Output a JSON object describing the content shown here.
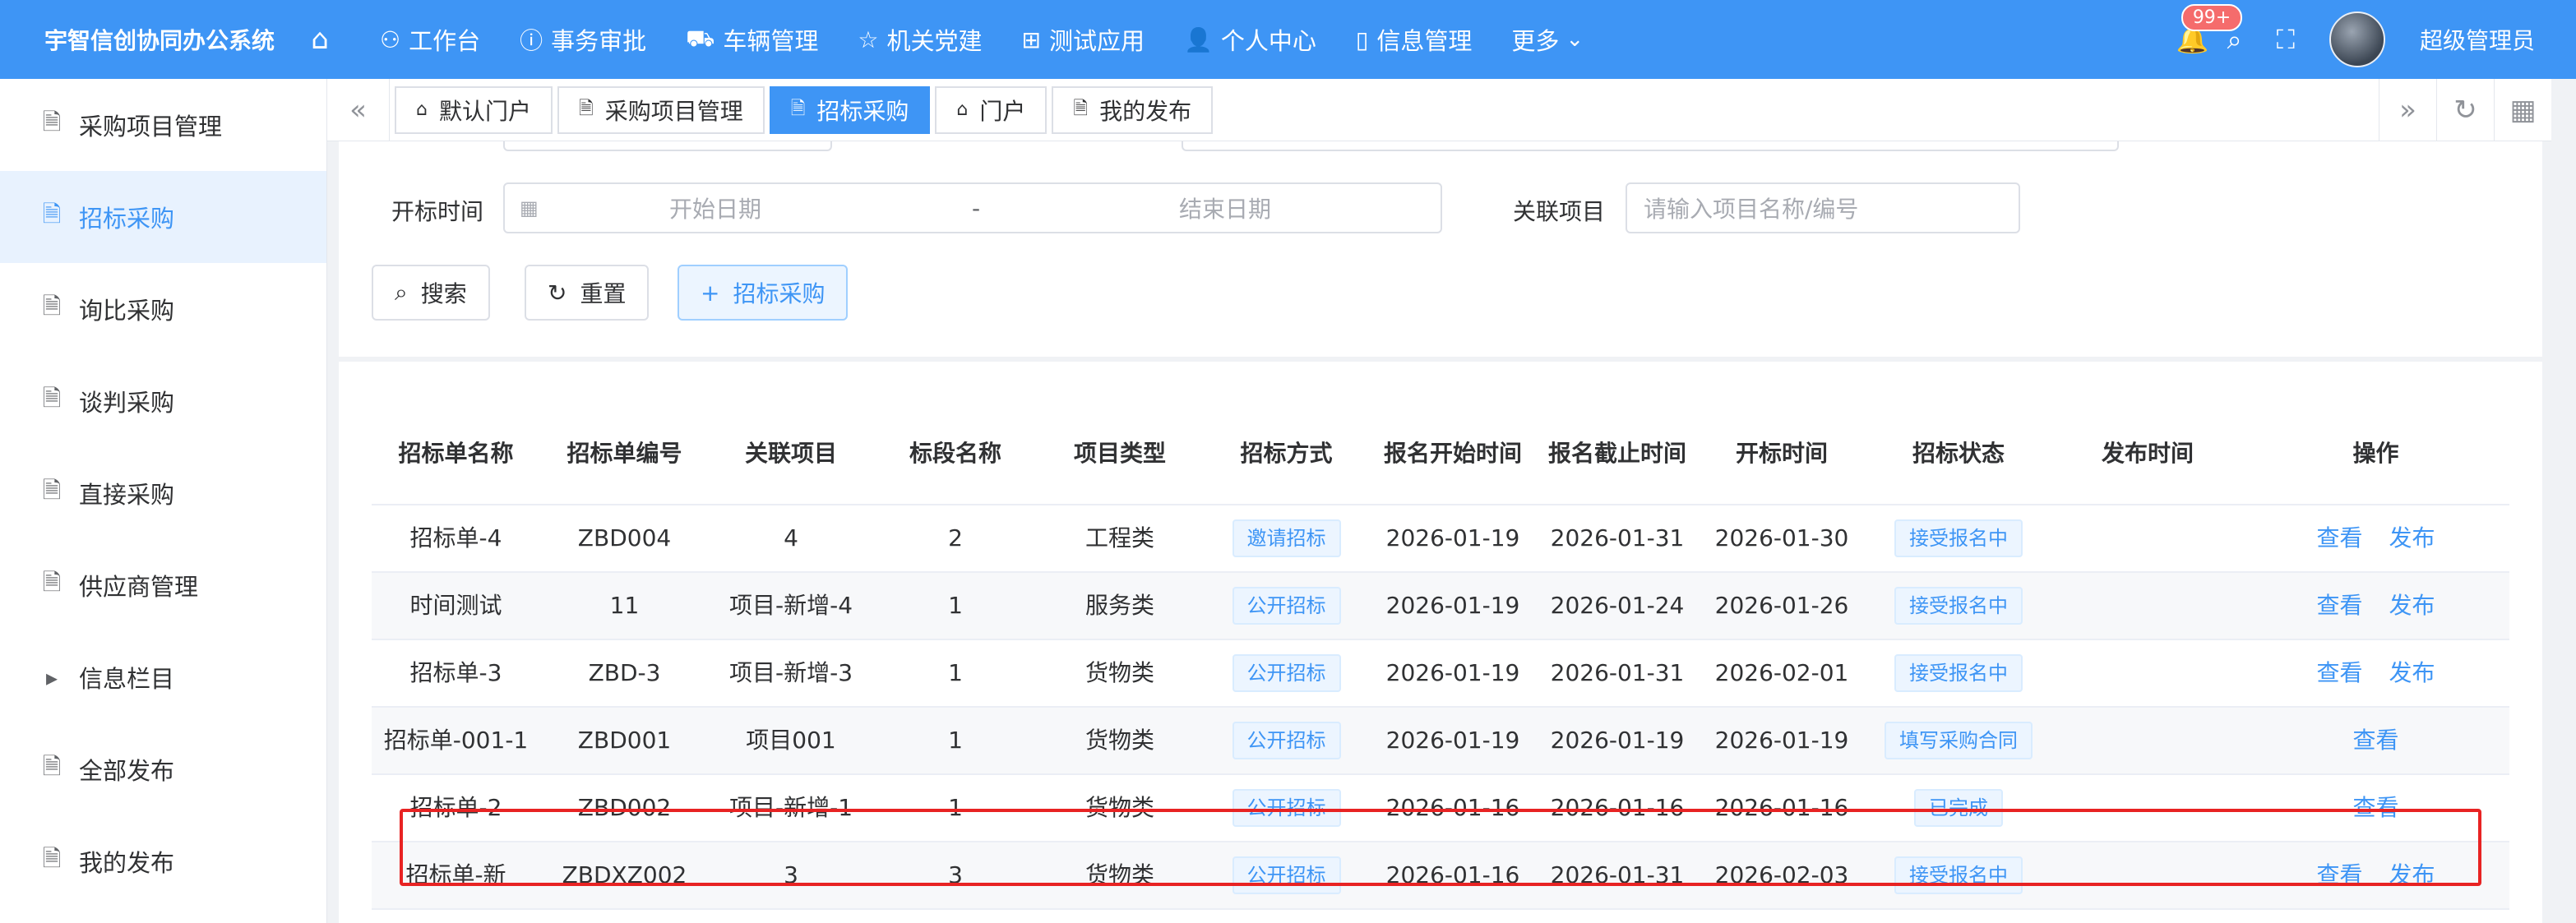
{
  "app": {
    "title": "宇智信创协同办公系统",
    "nav": [
      {
        "icon": "workbench-icon",
        "glyph": "⚇",
        "label": "工作台"
      },
      {
        "icon": "info-circle-icon",
        "glyph": "ⓘ",
        "label": "事务审批"
      },
      {
        "icon": "car-icon",
        "glyph": "⛟",
        "label": "车辆管理"
      },
      {
        "icon": "star-icon",
        "glyph": "☆",
        "label": "机关党建"
      },
      {
        "icon": "box-icon",
        "glyph": "⊞",
        "label": "测试应用"
      },
      {
        "icon": "user-icon",
        "glyph": "👤",
        "label": "个人中心"
      },
      {
        "icon": "book-icon",
        "glyph": "▯",
        "label": "信息管理"
      },
      {
        "icon": "chevron-down-icon",
        "glyph": "⌄",
        "label": "更多"
      }
    ],
    "notification_count": "99+",
    "user_name": "超级管理员"
  },
  "sidebar": {
    "items": [
      {
        "label": "采购项目管理",
        "icon": "document-icon",
        "active": false
      },
      {
        "label": "招标采购",
        "icon": "document-icon",
        "active": true
      },
      {
        "label": "询比采购",
        "icon": "document-icon",
        "active": false
      },
      {
        "label": "谈判采购",
        "icon": "document-icon",
        "active": false
      },
      {
        "label": "直接采购",
        "icon": "document-icon",
        "active": false
      },
      {
        "label": "供应商管理",
        "icon": "document-icon",
        "active": false
      },
      {
        "label": "信息栏目",
        "icon": "caret-right-icon",
        "active": false
      },
      {
        "label": "全部发布",
        "icon": "document-icon",
        "active": false
      },
      {
        "label": "我的发布",
        "icon": "document-icon",
        "active": false
      }
    ]
  },
  "tabs": [
    {
      "label": "默认门户",
      "icon": "home-icon",
      "active": false
    },
    {
      "label": "采购项目管理",
      "icon": "document-icon",
      "active": false
    },
    {
      "label": "招标采购",
      "icon": "document-icon",
      "active": true
    },
    {
      "label": "门户",
      "icon": "home-icon",
      "active": false
    },
    {
      "label": "我的发布",
      "icon": "document-icon",
      "active": false
    }
  ],
  "search": {
    "open_time_label": "开标时间",
    "start_placeholder": "开始日期",
    "range_separator": "-",
    "end_placeholder": "结束日期",
    "project_label": "关联项目",
    "project_placeholder": "请输入项目名称/编号",
    "search_btn": "搜索",
    "reset_btn": "重置",
    "add_btn": "招标采购"
  },
  "table": {
    "columns": [
      "招标单名称",
      "招标单编号",
      "关联项目",
      "标段名称",
      "项目类型",
      "招标方式",
      "报名开始时间",
      "报名截止时间",
      "开标时间",
      "招标状态",
      "发布时间",
      "操作"
    ],
    "rows": [
      {
        "name": "招标单-4",
        "code": "ZBD004",
        "project": "4",
        "section": "2",
        "type": "工程类",
        "method": "邀请招标",
        "reg_start": "2026-01-19",
        "reg_end": "2026-01-31",
        "open": "2026-01-30",
        "status": "接受报名中",
        "publish": "",
        "ops": [
          "查看",
          "发布"
        ]
      },
      {
        "name": "时间测试",
        "code": "11",
        "project": "项目-新增-4",
        "section": "1",
        "type": "服务类",
        "method": "公开招标",
        "reg_start": "2026-01-19",
        "reg_end": "2026-01-24",
        "open": "2026-01-26",
        "status": "接受报名中",
        "publish": "",
        "ops": [
          "查看",
          "发布"
        ]
      },
      {
        "name": "招标单-3",
        "code": "ZBD-3",
        "project": "项目-新增-3",
        "section": "1",
        "type": "货物类",
        "method": "公开招标",
        "reg_start": "2026-01-19",
        "reg_end": "2026-01-31",
        "open": "2026-02-01",
        "status": "接受报名中",
        "publish": "",
        "ops": [
          "查看",
          "发布"
        ]
      },
      {
        "name": "招标单-001-1",
        "code": "ZBD001",
        "project": "项目001",
        "section": "1",
        "type": "货物类",
        "method": "公开招标",
        "reg_start": "2026-01-19",
        "reg_end": "2026-01-19",
        "open": "2026-01-19",
        "status": "填写采购合同",
        "publish": "",
        "ops": [
          "查看"
        ]
      },
      {
        "name": "招标单-2",
        "code": "ZBD002",
        "project": "项目-新增-1",
        "section": "1",
        "type": "货物类",
        "method": "公开招标",
        "reg_start": "2026-01-16",
        "reg_end": "2026-01-16",
        "open": "2026-01-16",
        "status": "已完成",
        "publish": "",
        "ops": [
          "查看"
        ]
      },
      {
        "name": "招标单-新",
        "code": "ZBDXZ002",
        "project": "3",
        "section": "3",
        "type": "货物类",
        "method": "公开招标",
        "reg_start": "2026-01-16",
        "reg_end": "2026-01-31",
        "open": "2026-02-03",
        "status": "接受报名中",
        "publish": "",
        "ops": [
          "查看",
          "发布"
        ]
      }
    ]
  },
  "colors": {
    "accent": "#3e95f5",
    "highlight_border": "#e82323",
    "topbar": "#3e95f5"
  }
}
